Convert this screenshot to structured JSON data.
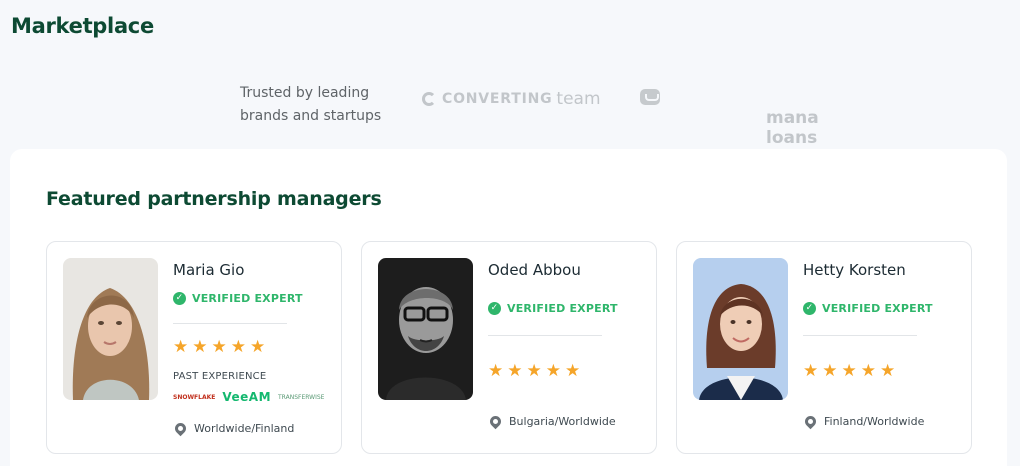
{
  "header": {
    "title": "Marketplace"
  },
  "trusted": {
    "text_line1": "Trusted by leading",
    "text_line2": "brands and startups",
    "brands": [
      {
        "bold": "CONVERTING",
        "light": "team",
        "icon": "converting-logo-icon"
      },
      {
        "name": "mana loans",
        "icon": "mana-logo-icon"
      }
    ]
  },
  "featured": {
    "title": "Featured partnership managers",
    "managers": [
      {
        "name": "Maria Gio",
        "badge": "VERIFIED EXPERT",
        "rating": 5,
        "past_experience_label": "PAST EXPERIENCE",
        "past_logos": [
          "SNOWFLAKE",
          "VeeAM",
          "TRANSFERWISE"
        ],
        "location": "Worldwide/Finland"
      },
      {
        "name": "Oded Abbou",
        "badge": "VERIFIED EXPERT",
        "rating": 5,
        "location": "Bulgaria/Worldwide"
      },
      {
        "name": "Hetty Korsten",
        "badge": "VERIFIED EXPERT",
        "rating": 5,
        "location": "Finland/Worldwide"
      }
    ]
  },
  "colors": {
    "brand_green": "#0d4a33",
    "verified_green": "#2fb66b",
    "star_orange": "#f5a52a"
  }
}
